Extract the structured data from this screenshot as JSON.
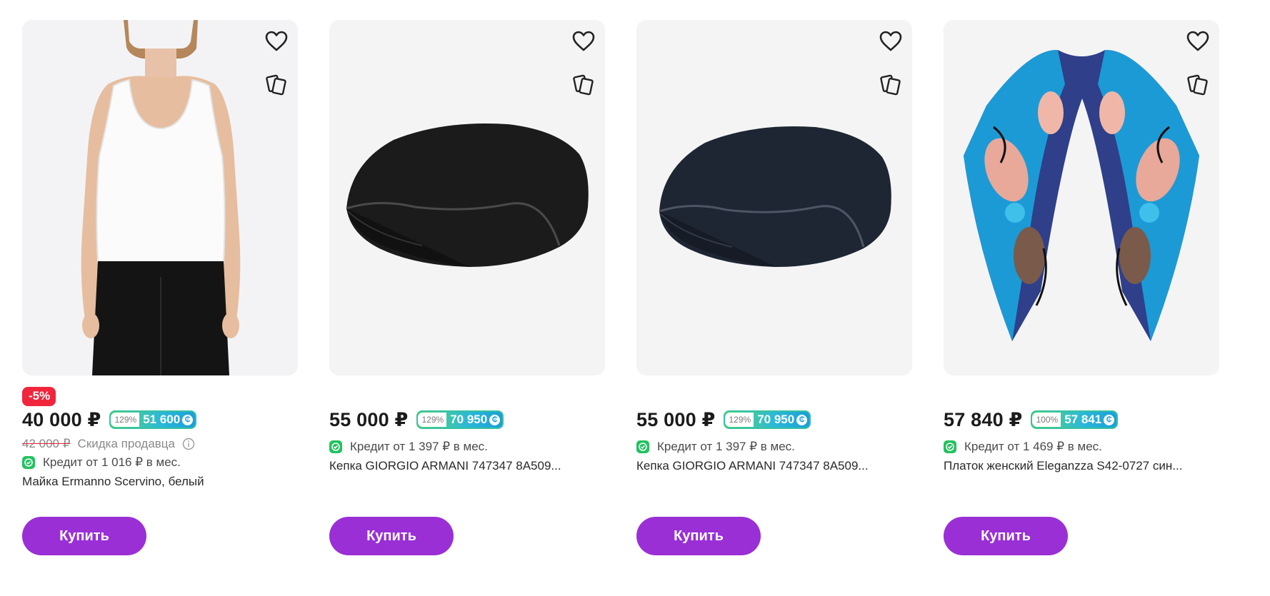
{
  "currency": "₽",
  "products": [
    {
      "discount_badge": "-5%",
      "price": "40 000 ₽",
      "bonus_pct": "129%",
      "bonus_value": "51 600",
      "old_price": "42 000 ₽",
      "seller_discount": "Скидка продавца",
      "credit": "Кредит от 1 016 ₽ в мес.",
      "title": "Майка Ermanno Scervino, белый",
      "buy_label": "Купить",
      "image_icon": "white-tank-top-photo"
    },
    {
      "price": "55 000 ₽",
      "bonus_pct": "129%",
      "bonus_value": "70 950",
      "credit": "Кредит от 1 397 ₽ в мес.",
      "title": "Кепка GIORGIO ARMANI 747347 8A509...",
      "buy_label": "Купить",
      "image_icon": "black-flat-cap-photo"
    },
    {
      "price": "55 000 ₽",
      "bonus_pct": "129%",
      "bonus_value": "70 950",
      "credit": "Кредит от 1 397 ₽ в мес.",
      "title": "Кепка GIORGIO ARMANI 747347 8A509...",
      "buy_label": "Купить",
      "image_icon": "navy-flat-cap-photo"
    },
    {
      "price": "57 840 ₽",
      "bonus_pct": "100%",
      "bonus_value": "57 841",
      "credit": "Кредит от 1 469 ₽ в мес.",
      "title": "Платок женский Eleganzza S42-0727 син...",
      "buy_label": "Купить",
      "image_icon": "floral-scarf-photo"
    }
  ],
  "colors": {
    "buy_button": "#9a2fd6",
    "discount_badge": "#f1253b",
    "credit_icon": "#21c25e",
    "bonus_gradient_start": "#5bd86c",
    "bonus_gradient_end": "#1a9fd8"
  },
  "icons": [
    "heart-icon",
    "compare-icon",
    "info-icon",
    "credit-check-icon",
    "bonus-coin-icon"
  ]
}
